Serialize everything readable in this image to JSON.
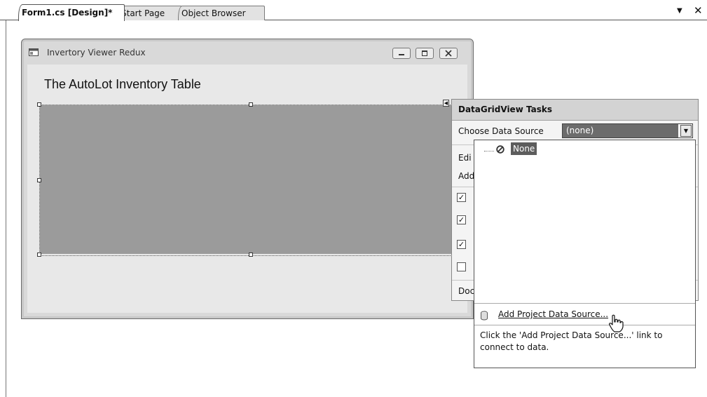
{
  "tabs": [
    {
      "label": "Form1.cs [Design]*",
      "active": true
    },
    {
      "label": "Start Page",
      "active": false
    },
    {
      "label": "Object Browser",
      "active": false
    }
  ],
  "tab_icons": {
    "menu": "dropdown-arrow-icon",
    "close": "close-icon"
  },
  "form": {
    "title": "Invertory Viewer Redux",
    "label": "The AutoLot Inventory Table",
    "icon": "form-app-icon",
    "caption_buttons": [
      "minimize",
      "maximize",
      "close"
    ]
  },
  "tasks": {
    "title": "DataGridView Tasks",
    "choose_label": "Choose Data Source",
    "combo_value": "(none)",
    "partial_links": [
      "Edi",
      "Add",
      "Doc"
    ],
    "checkboxes": [
      true,
      true,
      true,
      false
    ]
  },
  "dropdown": {
    "tree_item": "None",
    "add_link": "Add Project Data Source...",
    "help_text": "Click the 'Add Project Data Source...' link to connect to data."
  },
  "colors": {
    "grid_fill": "#9b9b9b",
    "selection": "#5d5d5d",
    "form_back": "#e8e8e8"
  }
}
